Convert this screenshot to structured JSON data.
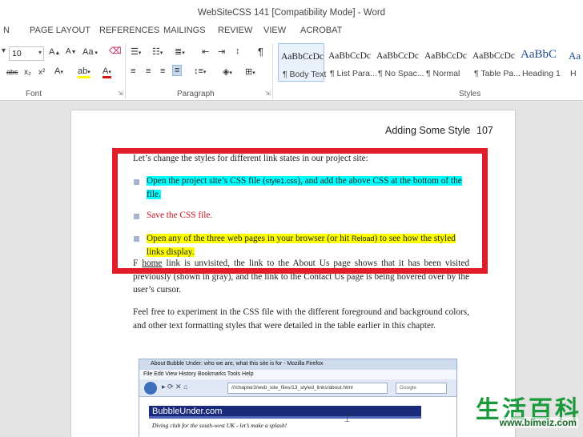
{
  "window": {
    "title": "WebSiteCSS 141 [Compatibility Mode] - Word"
  },
  "tabs": [
    "N",
    "PAGE LAYOUT",
    "REFERENCES",
    "MAILINGS",
    "REVIEW",
    "VIEW",
    "ACROBAT"
  ],
  "ribbon": {
    "font": {
      "size": "10",
      "label": "Font",
      "grow": "A",
      "shrink": "A",
      "case": "Aa",
      "strike": "abc",
      "subscript": "x₂",
      "superscript": "x²",
      "font_color": "A"
    },
    "paragraph": {
      "label": "Paragraph",
      "pilcrow": "¶"
    },
    "styles": {
      "label": "Styles",
      "items": [
        {
          "sample": "AaBbCcDc",
          "name": "¶ Body Text"
        },
        {
          "sample": "AaBbCcDc",
          "name": "¶ List Para..."
        },
        {
          "sample": "AaBbCcDc",
          "name": "¶ No Spac..."
        },
        {
          "sample": "AaBbCcDc",
          "name": "¶ Normal"
        },
        {
          "sample": "AaBbCcDc",
          "name": "¶ Table Pa..."
        },
        {
          "sample": "AaBbC",
          "name": "Heading 1"
        },
        {
          "sample": "Aa",
          "name": "H"
        }
      ]
    }
  },
  "document": {
    "header_title": "Adding Some Style",
    "page_number": "107",
    "intro": "Let’s change the styles for different link states in our project site:",
    "step1_a": "Open the project site’s CSS file (",
    "step1_file": "style1.css",
    "step1_b": "), and add the above CSS at the bottom of the file.",
    "step2": "Save the CSS file.",
    "step3_a": "Open any of the three web pages in your browser (or hit ",
    "step3_key": "Reload",
    "step3_b": ") to see how the styled links display.",
    "p2_prefix": "F",
    "p2_link": "home",
    "p2_rest": " link is unvisited, the link to the About Us page shows that it has been visited previously (shown in gray), and the link to the Contact Us page is being hovered over by the user’s cursor.",
    "p3": "Feel free to experiment in the CSS file with the different foreground and background colors, and other text formatting styles that were detailed in the table earlier in this chapter."
  },
  "screenshot": {
    "title": "About Bubble Under: who we are, what this site is for - Mozilla Firefox",
    "menu": "File   Edit   View   History   Bookmarks   Tools   Help",
    "url": "///chapter3/web_site_files/13_styled_links/about.html",
    "search": "Google",
    "banner": "BubbleUnder.com",
    "tagline": "Diving club for the south-west UK - let’s make a splash!"
  },
  "watermark": {
    "chinese": "生活百科",
    "url": "www.bimeiz.com"
  },
  "colors": {
    "highlight_cyan": "#00ffff",
    "highlight_yellow": "#ffff00",
    "callout_red": "#e11d2a",
    "text_red": "#c0111f"
  }
}
